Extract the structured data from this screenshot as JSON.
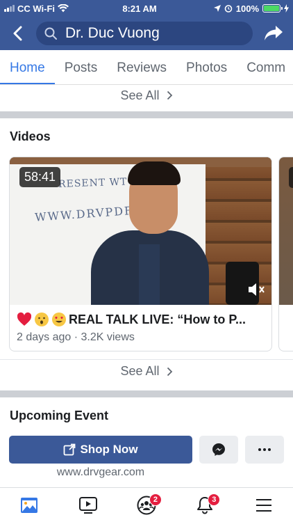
{
  "status_bar": {
    "carrier": "CC Wi-Fi",
    "time": "8:21 AM",
    "battery": "100%"
  },
  "nav": {
    "search_text": "Dr. Duc Vuong"
  },
  "tabs": [
    {
      "label": "Home",
      "active": true
    },
    {
      "label": "Posts",
      "active": false
    },
    {
      "label": "Reviews",
      "active": false
    },
    {
      "label": "Photos",
      "active": false
    },
    {
      "label": "Comm",
      "active": false
    }
  ],
  "see_all_label": "See All",
  "videos": {
    "section_title": "Videos",
    "card": {
      "duration": "58:41",
      "title": "REAL TALK LIVE: “How to P...",
      "meta": "2 days ago · 3.2K views",
      "board_line1": "RESENT WT REGAIN",
      "board_line2": "WWW.DRVPDF.COM"
    }
  },
  "upcoming_event": {
    "section_title": "Upcoming Event"
  },
  "actions": {
    "shop_label": "Shop Now",
    "website": "www.drvgear.com"
  },
  "bottom_nav": {
    "groups_badge": "2",
    "notifications_badge": "3"
  },
  "colors": {
    "brand": "#3b5998",
    "accent": "#3578e5",
    "badge": "#e41e3f"
  }
}
